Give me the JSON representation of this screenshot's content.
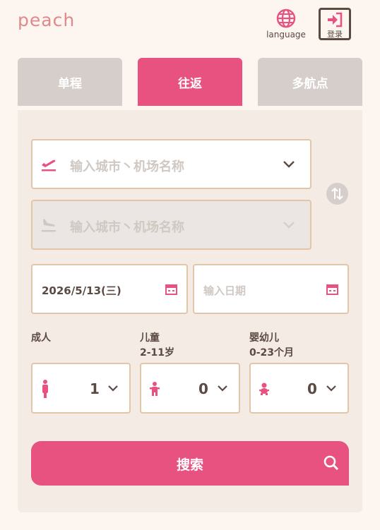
{
  "header": {
    "logo": "peach",
    "language_label": "language",
    "login_label": "登录"
  },
  "tabs": [
    {
      "label": "单程",
      "active": false
    },
    {
      "label": "往返",
      "active": true
    },
    {
      "label": "多航点",
      "active": false
    }
  ],
  "route": {
    "origin_placeholder": "输入城市丶机场名称",
    "destination_placeholder": "输入城市丶机场名称"
  },
  "dates": {
    "depart_value": "2026/5/13(三)",
    "return_placeholder": "输入日期"
  },
  "passengers": {
    "adult": {
      "label": "成人",
      "sub": "",
      "count": "1"
    },
    "child": {
      "label": "儿童",
      "sub": "2-11岁",
      "count": "0"
    },
    "infant": {
      "label": "婴幼儿",
      "sub": "0-23个月",
      "count": "0"
    }
  },
  "search_label": "搜索",
  "colors": {
    "accent": "#e75280",
    "inactive_tab": "#d6ceca",
    "panel": "#f4ebe4",
    "field_border": "#e3c5a8",
    "text": "#5a4a42"
  },
  "icons": [
    "globe-icon",
    "login-icon",
    "takeoff-icon",
    "landing-icon",
    "chevron-down-icon",
    "swap-icon",
    "calendar-icon",
    "adult-icon",
    "child-icon",
    "infant-icon",
    "search-icon"
  ]
}
